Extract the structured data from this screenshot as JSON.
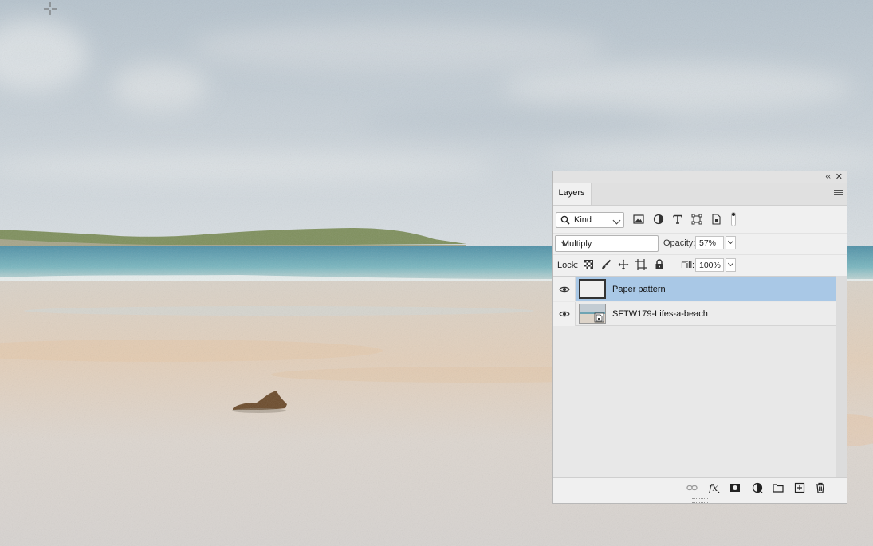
{
  "panel": {
    "tab_label": "Layers",
    "kind_filter": {
      "selected": "Kind",
      "icons": [
        "image-filter-icon",
        "adjustment-filter-icon",
        "type-filter-icon",
        "shape-filter-icon",
        "smart-object-filter-icon"
      ]
    },
    "blend_mode": "Multiply",
    "opacity_label": "Opacity:",
    "opacity_value": "57%",
    "lock_label": "Lock:",
    "fill_label": "Fill:",
    "fill_value": "100%",
    "layers": [
      {
        "name": "Paper pattern",
        "visible": true,
        "selected": true
      },
      {
        "name": "SFTW179-Lifes-a-beach",
        "visible": true,
        "selected": false,
        "smart_object": true
      }
    ],
    "footer_icons": [
      "link-layers-icon",
      "fx-icon",
      "layer-mask-icon",
      "adjustment-layer-icon",
      "new-group-icon",
      "new-layer-icon",
      "delete-layer-icon"
    ]
  },
  "colors": {
    "selection": "#a9c8e6",
    "panel_bg": "#f0f0f0",
    "sea": "#5fa3b4",
    "sand": "#ddd3c6",
    "sky": "#c4ced6"
  }
}
